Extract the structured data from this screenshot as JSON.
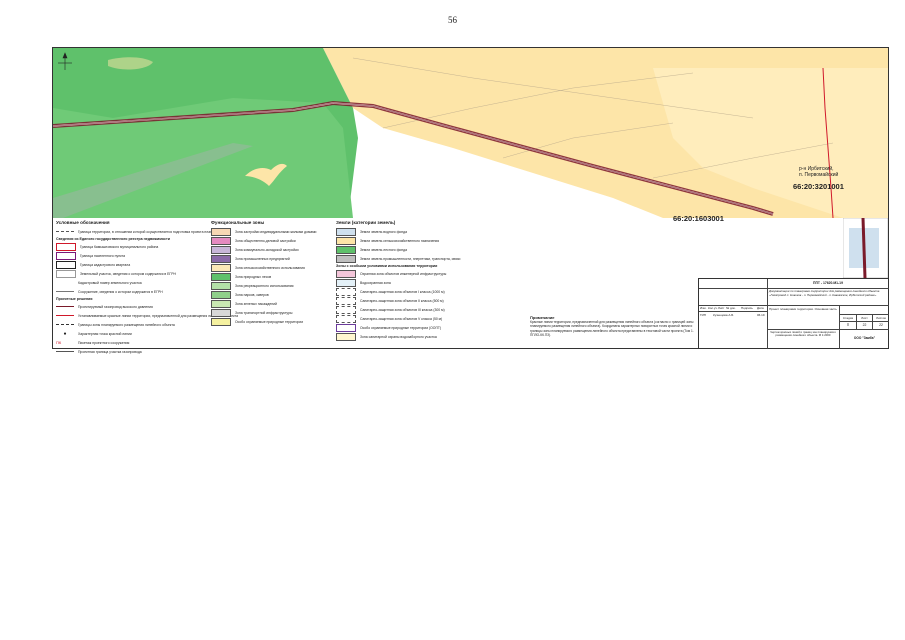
{
  "page_number": "56",
  "map": {
    "cadastral_labels": [
      "66:20:3201001",
      "66:20:1603001"
    ],
    "locality_label": [
      "р-н Ирбитский,",
      "п. Первомайский"
    ],
    "colors": {
      "forest": "#5fc16b",
      "forest_light": "#7ccf7f",
      "agri": "#fde5a8",
      "route": "#7a1a2a",
      "boundary": "#d0182a"
    }
  },
  "legend": {
    "title": "Условные обозначения",
    "sub_egrn": "Сведения из Единого государственного реестра недвижимости",
    "sub_project": "Проектные решения",
    "col1_items": [
      "Граница территории, в отношении которой осуществляется подготовка проекта планировки",
      "Граница Камышловского муниципального района",
      "Граница населенного пункта",
      "Граница кадастрового квартала",
      "Земельный участок, сведения о котором содержатся в ЕГРН",
      "Кадастровый номер земельного участка",
      "Сооружение, сведения о котором содержатся в ЕГРН",
      "Проектируемый газопровод высокого давления",
      "Устанавливаемые красные линии территории, предназначенной для размещения линейного объекта",
      "Границы зоны планируемого размещения линейного объекта",
      "Характерная точка красной линии",
      "Пикетаж проектного сооружения",
      "Проектная граница участка газопровода"
    ],
    "col2_head": "Функциональные зоны",
    "col2_items": [
      "Зона застройки индивидуальными жилыми домами",
      "Зона общественно-деловой застройки",
      "Зона коммунально-складской застройки",
      "Зона промышленных предприятий",
      "Зона сельскохозяйственного использования",
      "Зона природных лесов",
      "Зона рекреационного использования",
      "Зона парков, скверов",
      "Зона зеленых насаждений",
      "Зона транспортной инфраструктуры",
      "Особо охраняемые природные территории"
    ],
    "col3_head": "Земли (категории земель)",
    "col3_items": [
      "Земли земель водного фонда",
      "Земли земель сельскохозяйственного назначения",
      "Земли земель лесного фонда",
      "Земли земель промышленности, энергетики, транспорта, связи",
      "Охранная зона объектов инженерной инфраструктуры",
      "Водоохранная зона",
      "Санитарно-защитная зона объектов I класса (1000 м)",
      "Санитарно-защитная зона объектов II класса (500 м)",
      "Санитарно-защитная зона объектов III класса (300 м)",
      "Санитарно-защитная зона объектов V класса (50 м)",
      "Особо охраняемые природные территории (ООПТ)",
      "Зона санитарной охраны водозаборного участка"
    ],
    "col3_sub": "Зоны с особыми условиями использования территории",
    "notes_head": "Примечание",
    "notes_text": "Красные линии территории, предназначенной для размещения линейного объекта (согласно с границей зоны планируемого размещения линейного объекта). Координаты характерных поворотных точек красной линии и границы зоны планируемого размещения линейного объекта представлены в текстовой части проекта (Том 1. ППЛО-КК.ПЗ)."
  },
  "title_block": {
    "code": "ППТ - 17620.М1-19",
    "project": "Документация по планировке территории для размещения линейного объекта «Газопровод п. Новиков - п. Первомайский - п. Кавказское, Ирбитский районе»",
    "sheet_title": "Проект планировки территории. Основная часть",
    "drawing": "Чертеж красных линий и границ зон планируемого размещения линейного объекта. М 1:2000",
    "stage": "П",
    "sheet": "22",
    "sheets": "22",
    "company": "ООО \"Замба\"",
    "author": "Кузнецова А.Б.",
    "headers": [
      "Изм.",
      "Кол.уч.",
      "Лист",
      "№ док.",
      "Подпись",
      "Дата"
    ],
    "stage_headers": [
      "Стадия",
      "Лист",
      "Листов"
    ],
    "row_label": "ГИП",
    "date": "06.19"
  }
}
